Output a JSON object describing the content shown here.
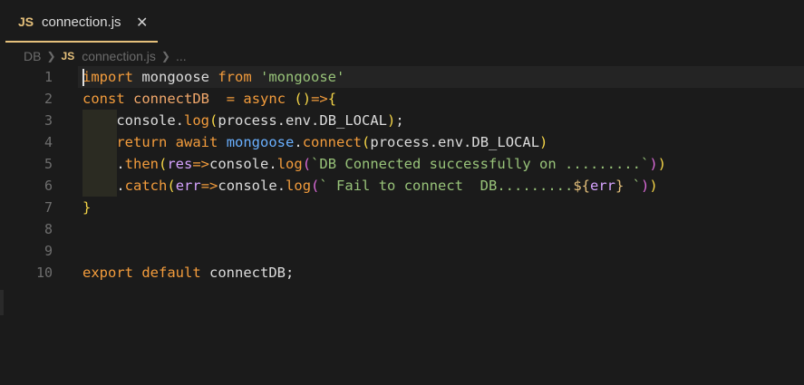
{
  "tab": {
    "badge": "JS",
    "filename": "connection.js",
    "close_glyph": "✕"
  },
  "breadcrumb": {
    "folder": "DB",
    "badge": "JS",
    "file": "connection.js",
    "more": "..."
  },
  "lines": [
    {
      "n": "1",
      "code": "import mongoose from 'mongoose'"
    },
    {
      "n": "2",
      "code": "const connectDB  = async ()=>{"
    },
    {
      "n": "3",
      "code": "    console.log(process.env.DB_LOCAL);"
    },
    {
      "n": "4",
      "code": "    return await mongoose.connect(process.env.DB_LOCAL)"
    },
    {
      "n": "5",
      "code": "    .then(res=>console.log(`DB Connected successfully on .........`))"
    },
    {
      "n": "6",
      "code": "    .catch(err=>console.log(` Fail to connect  DB.........${err} `))"
    },
    {
      "n": "7",
      "code": "}"
    },
    {
      "n": "8",
      "code": ""
    },
    {
      "n": "9",
      "code": ""
    },
    {
      "n": "10",
      "code": "export default connectDB;"
    }
  ],
  "theme": {
    "background": "#1b1b1b",
    "keyword": "#f39c3c",
    "string": "#98c379",
    "accent": "#e5c07b"
  }
}
